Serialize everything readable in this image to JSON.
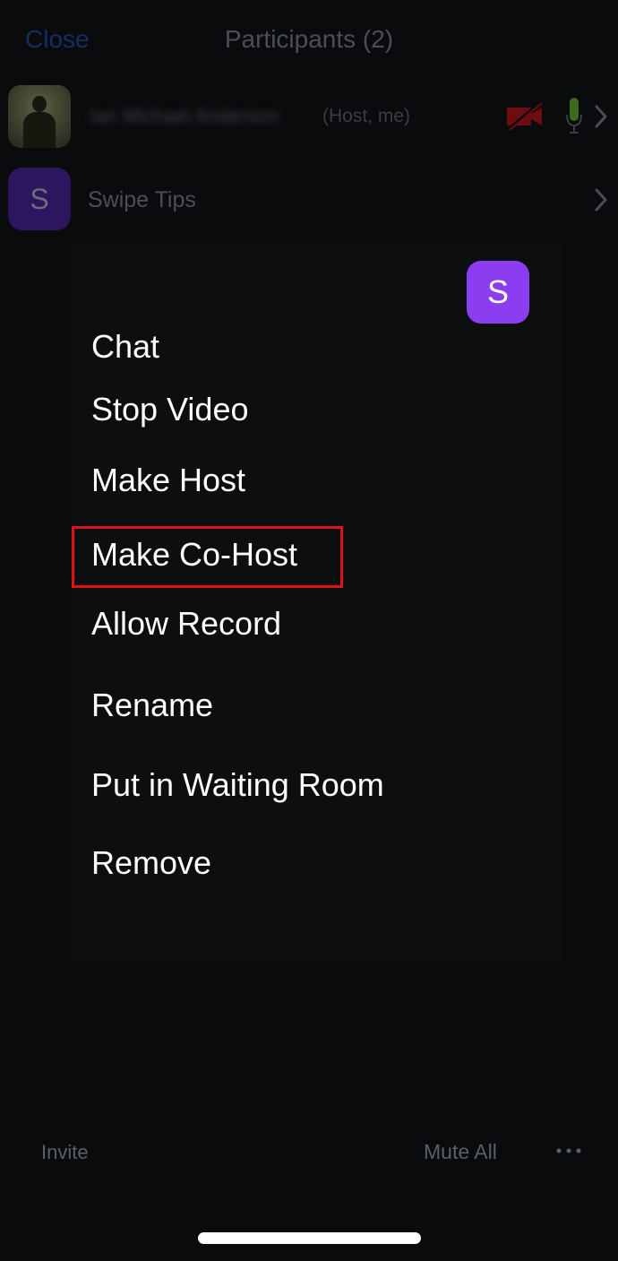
{
  "header": {
    "close_label": "Close",
    "title": "Participants (2)"
  },
  "participants": [
    {
      "name": "Ian Michael Anderson",
      "tag": "(Host, me)",
      "video_status": "video-off",
      "audio_status": "mic-active"
    },
    {
      "initial": "S",
      "name": "Swipe Tips"
    }
  ],
  "popup": {
    "avatar_initial": "S",
    "menu": [
      "Chat",
      "Stop Video",
      "Make Host",
      "Make Co-Host",
      "Allow Record",
      "Rename",
      "Put in Waiting Room",
      "Remove"
    ],
    "highlighted_item": "Make Co-Host",
    "highlight_color": "#e01217"
  },
  "footer": {
    "invite_label": "Invite",
    "mute_all_label": "Mute All",
    "more_icon": "more-horizontal-icon"
  },
  "colors": {
    "accent_purple": "#8c3df0",
    "close_blue": "#142e63",
    "video_off_red": "#6e0c10",
    "mic_green": "#3f6a1d"
  }
}
